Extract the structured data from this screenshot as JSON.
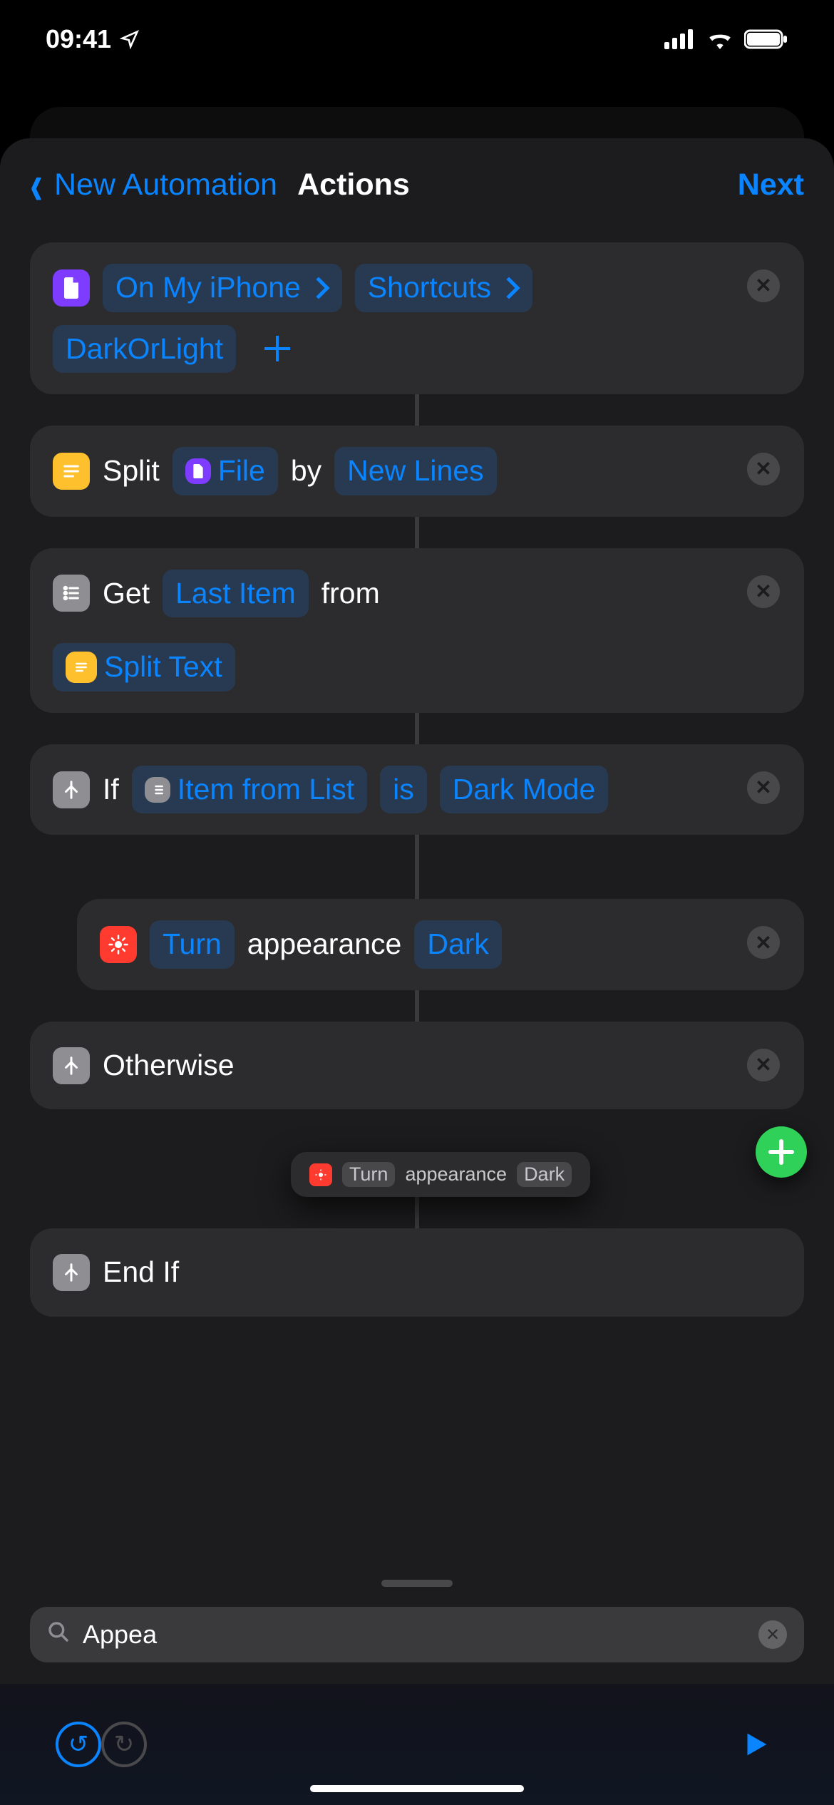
{
  "status": {
    "time": "09:41"
  },
  "nav": {
    "back": "New Automation",
    "title": "Actions",
    "next": "Next"
  },
  "a1": {
    "path_root": "On My iPhone",
    "path_mid": "Shortcuts",
    "path_leaf": "DarkOrLight"
  },
  "a2": {
    "verb": "Split",
    "var": "File",
    "by": "by",
    "arg": "New Lines"
  },
  "a3": {
    "verb": "Get",
    "arg": "Last Item",
    "from": "from",
    "var": "Split Text"
  },
  "a4": {
    "verb": "If",
    "var": "Item from List",
    "cond": "is",
    "val": "Dark Mode"
  },
  "a5": {
    "verb": "Turn",
    "noun": "appearance",
    "arg": "Dark"
  },
  "a6": {
    "verb": "Otherwise"
  },
  "drop": {
    "verb": "Turn",
    "noun": "appearance",
    "arg": "Dark"
  },
  "a7": {
    "verb": "End If"
  },
  "search": {
    "query": "Appea"
  }
}
